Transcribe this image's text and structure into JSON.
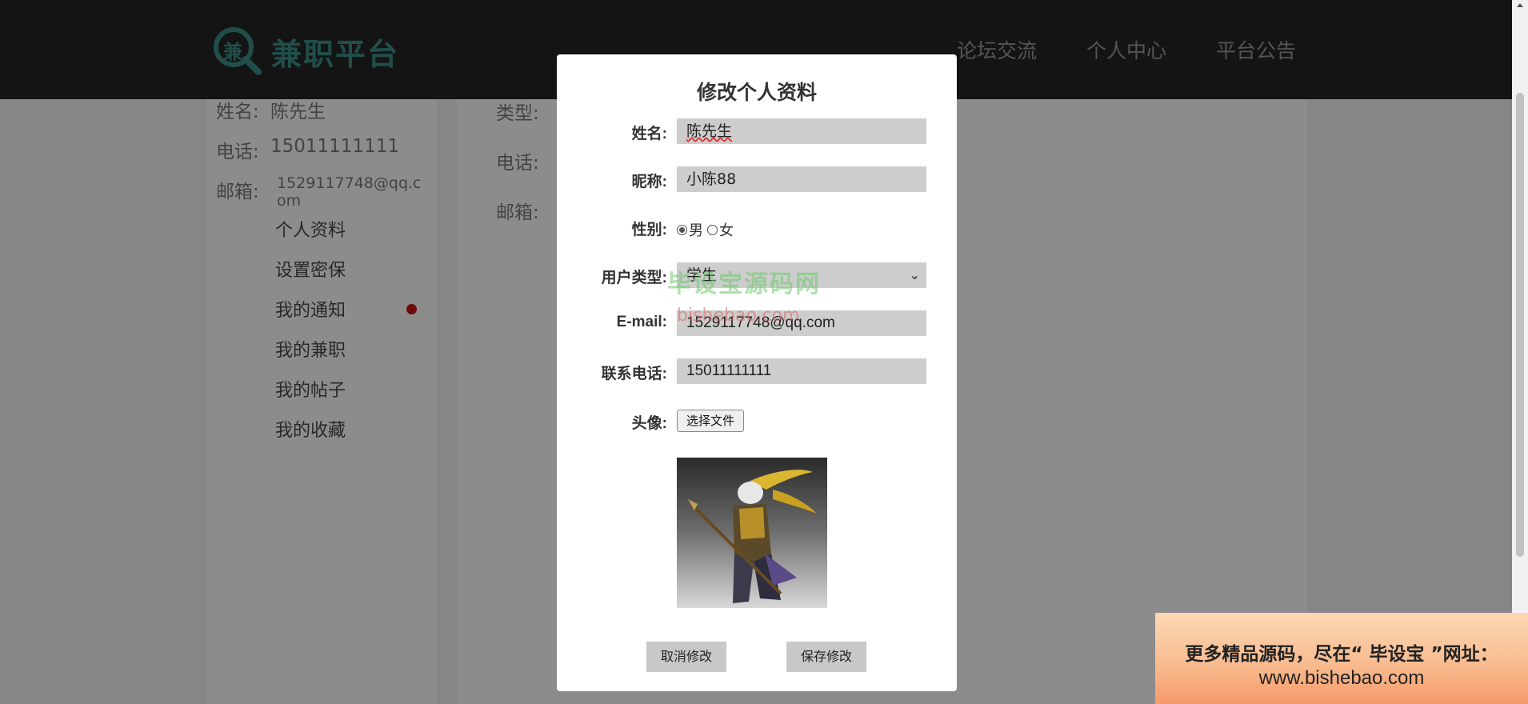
{
  "header": {
    "logo_char": "兼",
    "logo_text": "兼职平台",
    "nav": [
      "论坛交流",
      "个人中心",
      "平台公告"
    ]
  },
  "profile_panel": {
    "name_label": "姓名:",
    "name_value": "陈先生",
    "phone_label": "电话:",
    "phone_value": "15011111111",
    "email_label": "邮箱:",
    "email_value_line1": "1529117748@qq.c",
    "email_value_line2": "om",
    "menu": [
      "个人资料",
      "设置密保",
      "我的通知",
      "我的兼职",
      "我的帖子",
      "我的收藏"
    ]
  },
  "detail_panel": {
    "type_label": "类型:",
    "phone_label": "电话:",
    "email_label": "邮箱:"
  },
  "modal": {
    "title": "修改个人资料",
    "name_label": "姓名:",
    "name_value": "陈先生",
    "nickname_label": "昵称:",
    "nickname_value": "小陈88",
    "gender_label": "性别:",
    "gender_options": [
      "男",
      "女"
    ],
    "gender_selected": "男",
    "user_type_label": "用户类型:",
    "user_type_value": "学生",
    "email_label": "E-mail:",
    "email_value": "1529117748@qq.com",
    "phone_label": "联系电话:",
    "phone_value": "15011111111",
    "avatar_label": "头像:",
    "file_button": "选择文件",
    "cancel_button": "取消修改",
    "save_button": "保存修改"
  },
  "watermark": {
    "line1": "毕设宝源码网",
    "line2": "bishebao.com"
  },
  "ad": {
    "line1": "更多精品源码，尽在“ 毕设宝 ”网址：",
    "line2": "www.bishebao.com"
  },
  "colors": {
    "brand": "#3d8f88",
    "header_bg": "#262626",
    "notification_dot": "#cc1111"
  }
}
